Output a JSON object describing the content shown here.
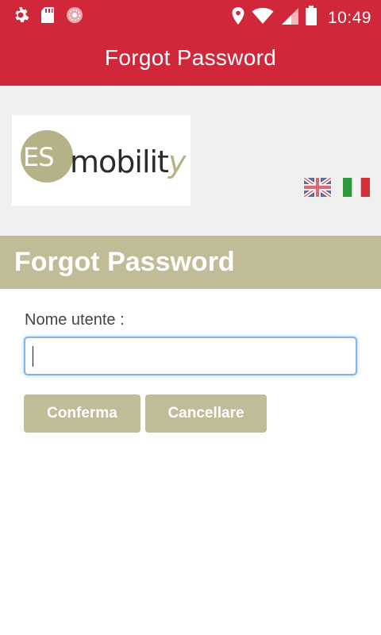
{
  "status_bar": {
    "icons_left": [
      "gear-icon",
      "sd-card-icon",
      "app-notification-icon"
    ],
    "icons_right": [
      "location-icon",
      "wifi-icon",
      "signal-icon",
      "battery-icon"
    ],
    "time": "10:49"
  },
  "app_bar": {
    "title": "Forgot Password"
  },
  "brand": {
    "logo_badge_text": "ES",
    "logo_word": "mobilit",
    "logo_word_accent": "y",
    "brand_color": "#b6b287"
  },
  "languages": [
    "English",
    "Italiano"
  ],
  "section": {
    "title": "Forgot Password"
  },
  "form": {
    "username_label": "Nome utente :",
    "username_value": "",
    "confirm_label": "Conferma",
    "cancel_label": "Cancellare"
  },
  "colors": {
    "primary": "#d0283a",
    "accent": "#bfbc97",
    "background": "#f0f0f0"
  }
}
